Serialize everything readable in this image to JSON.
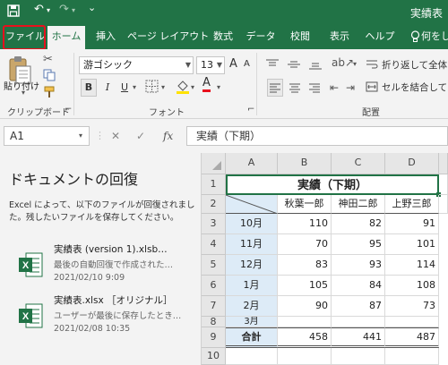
{
  "title_bar": {
    "doc_title": "実績表",
    "save_icon": "save-icon",
    "undo_icon": "undo-icon",
    "redo_icon": "redo-icon"
  },
  "tabs": [
    {
      "label": "ファイル",
      "name": "tab-file"
    },
    {
      "label": "ホーム",
      "name": "tab-home"
    },
    {
      "label": "挿入",
      "name": "tab-insert"
    },
    {
      "label": "ページ レイアウト",
      "name": "tab-page-layout"
    },
    {
      "label": "数式",
      "name": "tab-formulas"
    },
    {
      "label": "データ",
      "name": "tab-data"
    },
    {
      "label": "校閲",
      "name": "tab-review"
    },
    {
      "label": "表示",
      "name": "tab-view"
    },
    {
      "label": "ヘルプ",
      "name": "tab-help"
    },
    {
      "label": "何をし",
      "name": "tab-tell-me"
    }
  ],
  "ribbon": {
    "paste_label": "貼り付け",
    "clipboard_label": "クリップボード",
    "font_name": "游ゴシック",
    "font_size": "13",
    "font_label": "フォント",
    "bold": "B",
    "italic": "I",
    "underline": "U",
    "font_color_glyph": "A",
    "grow_font": "A",
    "shrink_font": "A",
    "wrap_text": "折り返して全体を表",
    "merge_center": "セルを結合して中央",
    "alignment_label": "配置",
    "launcher_glyph": "⌐",
    "font_color": "#e8101d",
    "fill_color": "#ffe200"
  },
  "formula_bar": {
    "name_box": "A1",
    "fx": "fx",
    "formula": "実績（下期）"
  },
  "recovery": {
    "title": "ドキュメントの回復",
    "description": "Excel によって、以下のファイルが回復されました。残したいファイルを保存してください。",
    "files": [
      {
        "name": "実績表 (version 1).xlsb…",
        "sub": "最後の自動回復で作成された…",
        "date": "2021/02/10 9:09"
      },
      {
        "name": "実績表.xlsx ［オリジナル］",
        "sub": "ユーザーが最後に保存したとき…",
        "date": "2021/02/08 10:35"
      }
    ]
  },
  "sheet": {
    "columns": [
      "A",
      "B",
      "C",
      "D"
    ],
    "rows": [
      "1",
      "2",
      "3",
      "4",
      "5",
      "6",
      "7",
      "8",
      "9",
      "10"
    ],
    "title": "実績（下期）",
    "headers": [
      "秋葉一郎",
      "神田二郎",
      "上野三郎"
    ],
    "data": [
      {
        "month": "10月",
        "values": [
          "110",
          "82",
          "91"
        ]
      },
      {
        "month": "11月",
        "values": [
          "70",
          "95",
          "101"
        ]
      },
      {
        "month": "12月",
        "values": [
          "83",
          "93",
          "114"
        ]
      },
      {
        "month": "1月",
        "values": [
          "105",
          "84",
          "108"
        ]
      },
      {
        "month": "2月",
        "values": [
          "90",
          "87",
          "73"
        ]
      },
      {
        "month": "3月",
        "values": [
          "",
          "",
          ""
        ]
      }
    ],
    "total": {
      "label": "合計",
      "values": [
        "458",
        "441",
        "487"
      ]
    }
  }
}
